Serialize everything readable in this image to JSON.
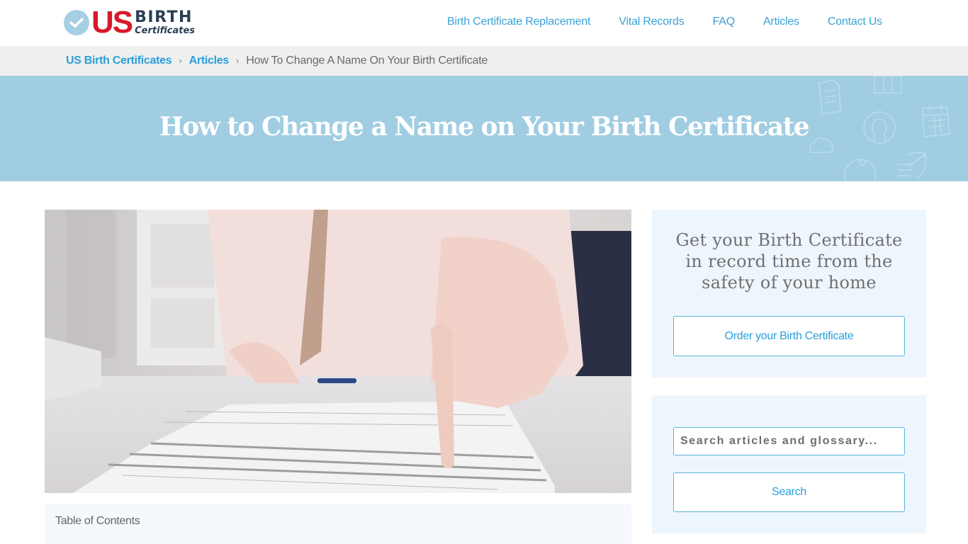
{
  "header": {
    "logo": {
      "mark": "US",
      "word1": "BIRTH",
      "word2": "Certificates",
      "icon": "checkmark-circle-icon"
    },
    "nav": [
      {
        "label": "Birth Certificate Replacement"
      },
      {
        "label": "Vital Records"
      },
      {
        "label": "FAQ"
      },
      {
        "label": "Articles"
      },
      {
        "label": "Contact Us"
      }
    ]
  },
  "breadcrumb": {
    "items": [
      {
        "label": "US Birth Certificates"
      },
      {
        "label": "Articles"
      }
    ],
    "separator": "›",
    "current": "How To Change A Name On Your Birth Certificate"
  },
  "hero": {
    "title": "How to Change a Name on Your Birth Certificate",
    "decor_icons": [
      "document-icon",
      "book-icon",
      "user-circle-icon",
      "calendar-icon",
      "cloud-icon",
      "clock-icon",
      "checklist-icon"
    ]
  },
  "article": {
    "image_alt": "Woman pointing at a form document on a desk",
    "toc_title": "Table of Contents"
  },
  "sidebar": {
    "cta": {
      "text": "Get your Birth Certificate in record time from the safety of your home",
      "button_label": "Order your Birth Certificate"
    },
    "search": {
      "placeholder": "Search articles and glossary...",
      "value": "",
      "button_label": "Search"
    }
  },
  "colors": {
    "brand_red": "#d7192a",
    "brand_navy": "#2b3f55",
    "link_blue": "#2a9fd8",
    "hero_bg": "#a0cde2",
    "card_bg": "#eef6fd",
    "breadcrumb_bg": "#efefef"
  }
}
